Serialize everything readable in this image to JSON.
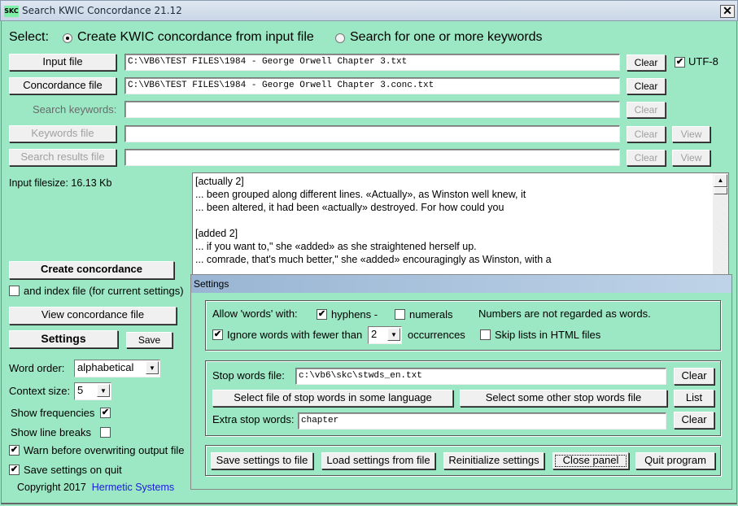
{
  "window": {
    "title": "Search KWIC Concordance 21.12",
    "icon_label": "SKC",
    "close_label": "✕"
  },
  "select": {
    "label": "Select:",
    "options": [
      {
        "label": "Create KWIC concordance from input file",
        "selected": true
      },
      {
        "label": "Search for one or more keywords",
        "selected": false
      }
    ]
  },
  "files": {
    "input_button": "Input file",
    "input_value": "C:\\VB6\\TEST FILES\\1984 - George Orwell Chapter 3.txt",
    "concordance_button": "Concordance file",
    "concordance_value": "C:\\VB6\\TEST FILES\\1984 - George Orwell Chapter 3.conc.txt",
    "search_keywords_label": "Search keywords:",
    "search_keywords_value": "",
    "keywords_file_button": "Keywords file",
    "keywords_file_value": "",
    "search_results_button": "Search results file",
    "search_results_value": "",
    "clear_label": "Clear",
    "view_label": "View",
    "utf8_label": "UTF-8",
    "utf8_checked": true
  },
  "left": {
    "filesize": "Input filesize: 16.13 Kb",
    "create_button": "Create concordance",
    "index_file_label": "and index file (for current settings)",
    "index_file_checked": false,
    "view_button": "View concordance file",
    "settings_button": "Settings",
    "save_button": "Save",
    "word_order_label": "Word order:",
    "word_order_value": "alphabetical",
    "context_size_label": "Context size:",
    "context_size_value": "5",
    "show_frequencies_label": "Show frequencies",
    "show_frequencies_checked": true,
    "show_line_breaks_label": "Show line breaks",
    "show_line_breaks_checked": false,
    "warn_overwrite_label": "Warn before overwriting output file",
    "warn_overwrite_checked": true,
    "save_on_quit_label": "Save settings on quit",
    "save_on_quit_checked": true,
    "copyright": "Copyright 2017",
    "company_link": "Hermetic Systems"
  },
  "output": {
    "lines": [
      "[actually 2]",
      "... been grouped along different lines. «Actually», as Winston well knew, it",
      "... been altered, it had been «actually» destroyed. For how could you",
      "",
      "[added 2]",
      "... if you want to,\" she «added» as she straightened herself up.",
      "... comrade, that's much better,\" she «added» encouragingly as Winston, with a"
    ]
  },
  "settings": {
    "title": "Settings",
    "allow_words_label": "Allow 'words' with:",
    "hyphens_label": "hyphens -",
    "hyphens_checked": true,
    "numerals_label": "numerals",
    "numerals_checked": false,
    "numbers_note": "Numbers are not regarded as words.",
    "ignore_label": "Ignore words with fewer than",
    "ignore_checked": true,
    "ignore_value": "2",
    "occurrences_label": "occurrences",
    "skip_lists_label": "Skip lists in HTML files",
    "skip_lists_checked": false,
    "stop_words_label": "Stop words file:",
    "stop_words_value": "c:\\vb6\\skc\\stwds_en.txt",
    "clear_label": "Clear",
    "select_language_button": "Select file of stop words in some language",
    "select_other_button": "Select some other stop words file",
    "list_button": "List",
    "extra_stop_label": "Extra stop words:",
    "extra_stop_value": "chapter",
    "save_to_file_button": "Save settings to file",
    "load_from_file_button": "Load settings from file",
    "reinitialize_button": "Reinitialize settings",
    "close_panel_button": "Close panel",
    "quit_button": "Quit program"
  }
}
